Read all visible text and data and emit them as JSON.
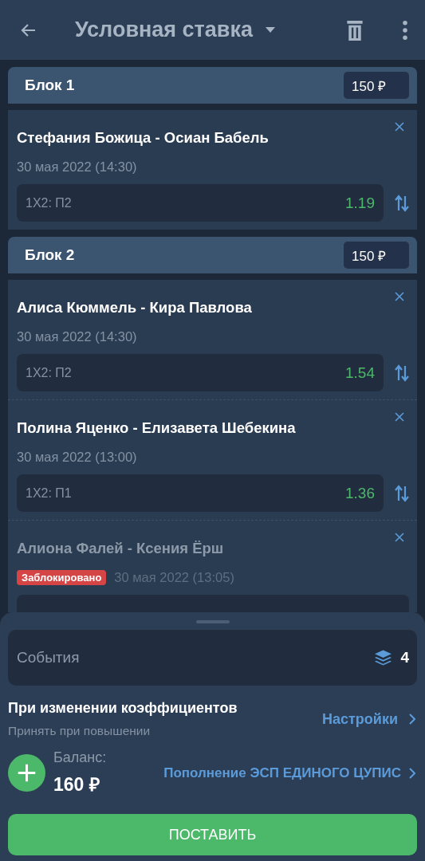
{
  "header": {
    "title": "Условная ставка"
  },
  "blocks": [
    {
      "title": "Блок 1",
      "stake": "150 ₽",
      "events": [
        {
          "match": "Стефания Божица - Осиан Бабель",
          "date": "30 мая 2022 (14:30)",
          "blocked": false,
          "market": "1X2: П2",
          "odds": "1.19"
        }
      ]
    },
    {
      "title": "Блок 2",
      "stake": "150 ₽",
      "events": [
        {
          "match": "Алиса Кюммель - Кира Павлова",
          "date": "30 мая 2022 (14:30)",
          "blocked": false,
          "market": "1X2: П2",
          "odds": "1.54"
        },
        {
          "match": "Полина Яценко - Елизавета Шебекина",
          "date": "30 мая 2022 (13:00)",
          "blocked": false,
          "market": "1X2: П1",
          "odds": "1.36"
        },
        {
          "match": "Алиона Фалей - Ксения Ёрш",
          "date": "30 мая 2022 (13:05)",
          "blocked": true,
          "badge": "Заблокировано"
        }
      ]
    }
  ],
  "sheet": {
    "events_label": "События",
    "events_count": "4",
    "odds_change_title": "При изменении коэффициентов",
    "odds_change_value": "Принять при повышении",
    "settings_link": "Настройки",
    "balance_label": "Баланс:",
    "balance": "160 ₽",
    "topup_link": "Пополнение ЭСП ЕДИНОГО ЦУПИС",
    "submit": "ПОСТАВИТЬ"
  }
}
